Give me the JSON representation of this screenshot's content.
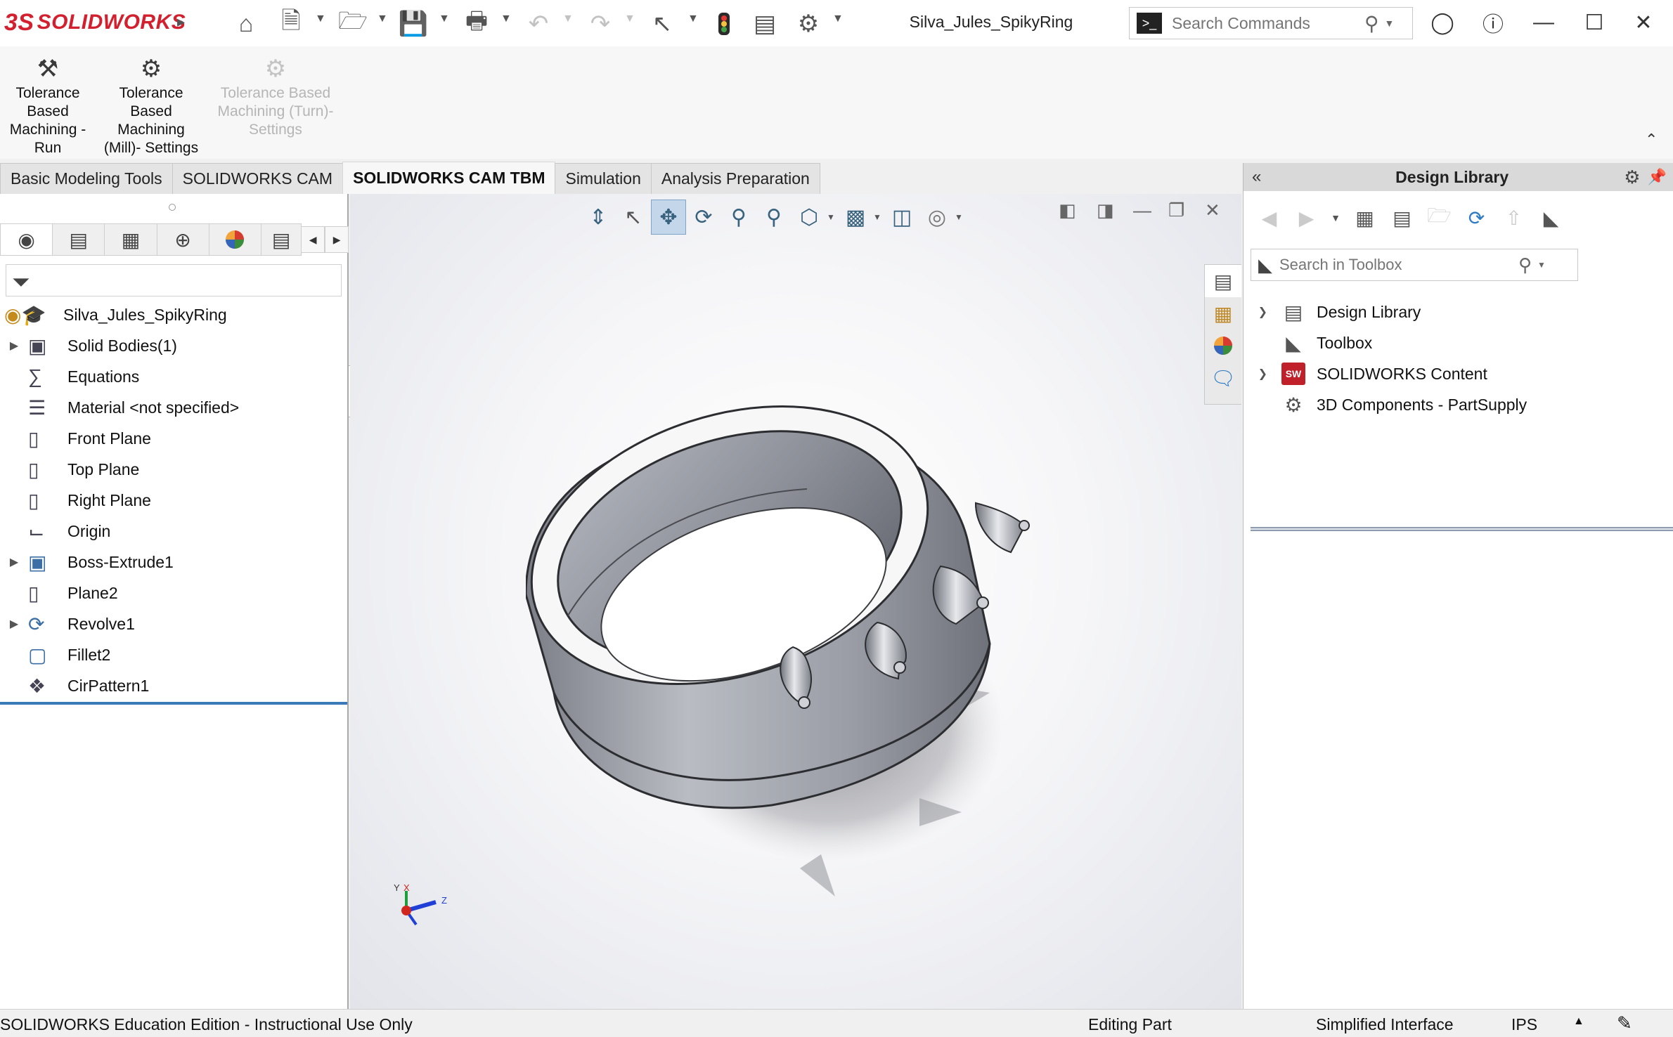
{
  "app": {
    "logo_ds": "3S",
    "logo_text": "SOLIDWORKS",
    "document_title": "Silva_Jules_SpikyRing"
  },
  "search_commands": {
    "placeholder": "Search Commands"
  },
  "ribbon": {
    "buttons": [
      {
        "label": "Tolerance Based Machining - Run",
        "icon": "machining-run-icon",
        "enabled": true
      },
      {
        "label": "Tolerance Based Machining (Mill)- Settings",
        "icon": "gear-icon",
        "enabled": true
      },
      {
        "label": "Tolerance Based Machining (Turn)- Settings",
        "icon": "gear-icon",
        "enabled": false
      }
    ]
  },
  "tabs": [
    {
      "label": "Basic Modeling Tools",
      "active": false
    },
    {
      "label": "SOLIDWORKS CAM",
      "active": false
    },
    {
      "label": "SOLIDWORKS CAM TBM",
      "active": true
    },
    {
      "label": "Simulation",
      "active": false
    },
    {
      "label": "Analysis Preparation",
      "active": false
    }
  ],
  "feature_tree": {
    "root": "Silva_Jules_SpikyRing",
    "items": [
      {
        "label": "Solid Bodies(1)",
        "icon": "solid-bodies-icon",
        "expandable": true
      },
      {
        "label": "Equations",
        "icon": "equations-icon",
        "expandable": false
      },
      {
        "label": "Material <not specified>",
        "icon": "material-icon",
        "expandable": false
      },
      {
        "label": "Front Plane",
        "icon": "plane-icon",
        "expandable": false
      },
      {
        "label": "Top Plane",
        "icon": "plane-icon",
        "expandable": false
      },
      {
        "label": "Right Plane",
        "icon": "plane-icon",
        "expandable": false
      },
      {
        "label": "Origin",
        "icon": "origin-icon",
        "expandable": false
      },
      {
        "label": "Boss-Extrude1",
        "icon": "extrude-icon",
        "expandable": true
      },
      {
        "label": "Plane2",
        "icon": "plane-icon",
        "expandable": false
      },
      {
        "label": "Revolve1",
        "icon": "revolve-icon",
        "expandable": true
      },
      {
        "label": "Fillet2",
        "icon": "fillet-icon",
        "expandable": false
      },
      {
        "label": "CirPattern1",
        "icon": "circular-pattern-icon",
        "expandable": false
      }
    ]
  },
  "triad": {
    "y": "Y",
    "x": "X",
    "z": "Z"
  },
  "design_library": {
    "title": "Design Library",
    "search": {
      "placeholder": "Search in Toolbox"
    },
    "items": [
      {
        "label": "Design Library",
        "icon": "design-library-icon",
        "expandable": true
      },
      {
        "label": "Toolbox",
        "icon": "toolbox-icon",
        "expandable": false
      },
      {
        "label": "SOLIDWORKS Content",
        "icon": "solidworks-content-icon",
        "expandable": true,
        "badge": "SW"
      },
      {
        "label": "3D Components - PartSupply",
        "icon": "partsupply-icon",
        "expandable": false
      }
    ]
  },
  "status_bar": {
    "left": "SOLIDWORKS Education Edition - Instructional Use Only",
    "mode": "Editing Part",
    "interface": "Simplified Interface",
    "units": "IPS"
  },
  "colors": {
    "brand": "#d2202f",
    "active_hud": "#c3d6ea",
    "tree_selection": "#3a7ab8"
  }
}
